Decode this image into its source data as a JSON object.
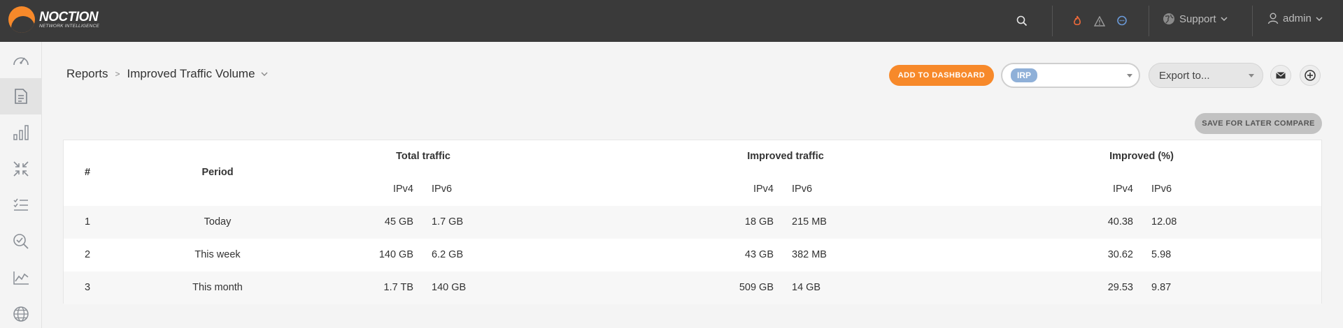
{
  "brand": {
    "name": "NOCTION",
    "tagline": "NETWORK INTELLIGENCE",
    "accent": "#f7892a"
  },
  "topbar": {
    "support_label": "Support",
    "user_label": "admin",
    "icons": [
      "search-icon",
      "fire-icon",
      "warning-icon",
      "chat-icon",
      "support-globe-icon",
      "user-icon"
    ]
  },
  "sidebar": {
    "items": [
      {
        "icon": "speedometer-icon"
      },
      {
        "icon": "document-icon",
        "active": true
      },
      {
        "icon": "bar-chart-icon"
      },
      {
        "icon": "compress-icon"
      },
      {
        "icon": "checklist-icon"
      },
      {
        "icon": "search-check-icon"
      },
      {
        "icon": "line-chart-icon"
      },
      {
        "icon": "globe-icon"
      }
    ]
  },
  "header": {
    "breadcrumb_root": "Reports",
    "breadcrumb_current": "Improved Traffic Volume",
    "add_dashboard_label": "ADD TO DASHBOARD",
    "irp_selected": "IRP",
    "export_placeholder": "Export to...",
    "save_compare_label": "SAVE FOR LATER COMPARE"
  },
  "table": {
    "col_index": "#",
    "col_period": "Period",
    "groups": [
      "Total traffic",
      "Improved traffic",
      "Improved (%)"
    ],
    "sub_ipv4": "IPv4",
    "sub_ipv6": "IPv6",
    "rows": [
      {
        "idx": "1",
        "period": "Today",
        "total_v4": "45 GB",
        "total_v6": "1.7 GB",
        "imp_v4": "18 GB",
        "imp_v6": "215 MB",
        "pct_v4": "40.38",
        "pct_v6": "12.08"
      },
      {
        "idx": "2",
        "period": "This week",
        "total_v4": "140 GB",
        "total_v6": "6.2 GB",
        "imp_v4": "43 GB",
        "imp_v6": "382 MB",
        "pct_v4": "30.62",
        "pct_v6": "5.98"
      },
      {
        "idx": "3",
        "period": "This month",
        "total_v4": "1.7 TB",
        "total_v6": "140 GB",
        "imp_v4": "509 GB",
        "imp_v6": "14 GB",
        "pct_v4": "29.53",
        "pct_v6": "9.87"
      }
    ]
  }
}
